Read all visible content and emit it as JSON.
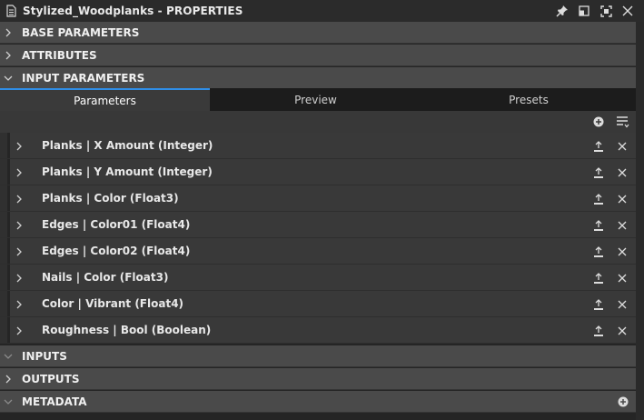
{
  "window": {
    "title": "Stylized_Woodplanks - PROPERTIES",
    "icons": [
      "document-icon",
      "pin-icon",
      "restore-icon",
      "fullscreen-icon",
      "close-icon"
    ]
  },
  "sections": {
    "base_parameters": "BASE PARAMETERS",
    "attributes": "ATTRIBUTES",
    "input_parameters": "INPUT PARAMETERS",
    "inputs": "INPUTS",
    "outputs": "OUTPUTS",
    "metadata": "METADATA"
  },
  "tabs": [
    {
      "label": "Parameters",
      "active": true
    },
    {
      "label": "Preview",
      "active": false
    },
    {
      "label": "Presets",
      "active": false
    }
  ],
  "parameters": [
    {
      "label": "Planks | X Amount (Integer)"
    },
    {
      "label": "Planks | Y Amount (Integer)"
    },
    {
      "label": "Planks | Color (Float3)"
    },
    {
      "label": "Edges | Color01 (Float4)"
    },
    {
      "label": "Edges | Color02 (Float4)"
    },
    {
      "label": "Nails | Color (Float3)"
    },
    {
      "label": "Color | Vibrant (Float4)"
    },
    {
      "label": "Roughness | Bool (Boolean)"
    }
  ],
  "colors": {
    "accent": "#2f8ee8",
    "section_bg": "#4a4a4a",
    "row_bg": "#393939"
  }
}
